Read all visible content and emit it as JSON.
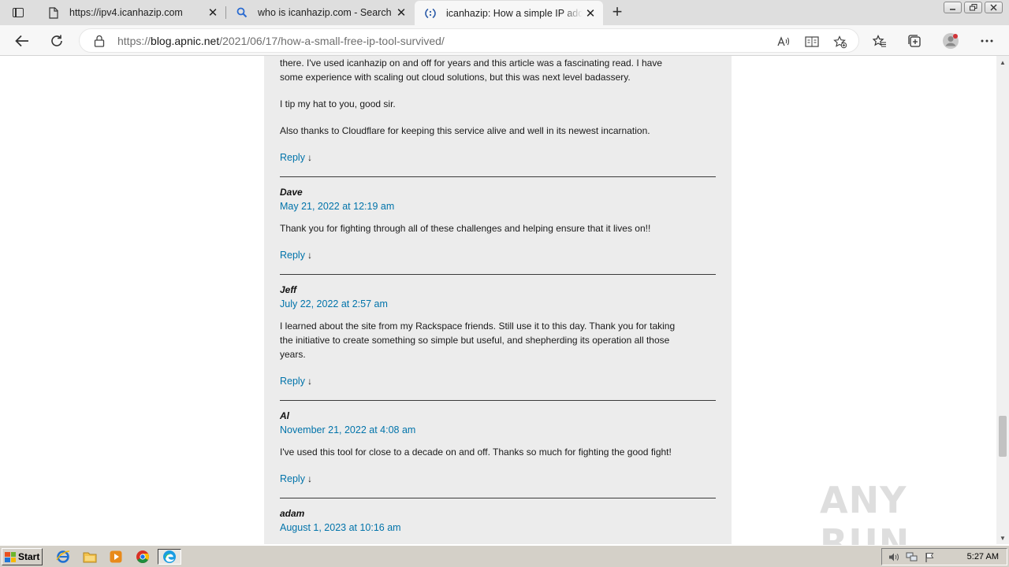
{
  "browser": {
    "tabs": [
      {
        "title": "https://ipv4.icanhazip.com",
        "icon": "page-icon"
      },
      {
        "title": "who is icanhazip.com - Search",
        "icon": "search-icon"
      },
      {
        "title": "icanhazip: How a simple IP addre",
        "icon": "site-favicon-icon",
        "active": true
      }
    ],
    "new_tab_label": "+",
    "url_prefix": "https://",
    "url_domain": "blog.apnic.net",
    "url_path": "/2021/06/17/how-a-small-free-ip-tool-survived/"
  },
  "comments": {
    "reply_label": "Reply",
    "reply_arrow": "↓",
    "partial": {
      "lines": [
        "there. I've used icanhazip on and off for years and this article was a fascinating read. I have",
        "some experience with scaling out cloud solutions, but this was next level badassery."
      ],
      "p2": "I tip my hat to you, good sir.",
      "p3": "Also thanks to Cloudflare for keeping this service alive and well in its newest incarnation."
    },
    "items": [
      {
        "author": "Dave",
        "date": "May 21, 2022 at 12:19 am",
        "lines": [
          "Thank you for fighting through all of these challenges and helping ensure that it lives on!!"
        ]
      },
      {
        "author": "Jeff",
        "date": "July 22, 2022 at 2:57 am",
        "lines": [
          "I learned about the site from my Rackspace friends. Still use it to this day. Thank you for taking",
          "the initiative to create something so simple but useful, and shepherding its operation all those",
          "years."
        ]
      },
      {
        "author": "Al",
        "date": "November 21, 2022 at 4:08 am",
        "lines": [
          "I've used this tool for close to a decade on and off. Thanks so much for fighting the good fight!"
        ]
      },
      {
        "author": "adam",
        "date": "August 1, 2023 at 10:16 am"
      }
    ]
  },
  "watermark": "ANY RUN",
  "taskbar": {
    "start_label": "Start",
    "clock": "5:27 AM"
  },
  "colors": {
    "link": "#0073aa",
    "content_bg": "#ececec",
    "taskbar_bg": "#d4d0c8"
  }
}
